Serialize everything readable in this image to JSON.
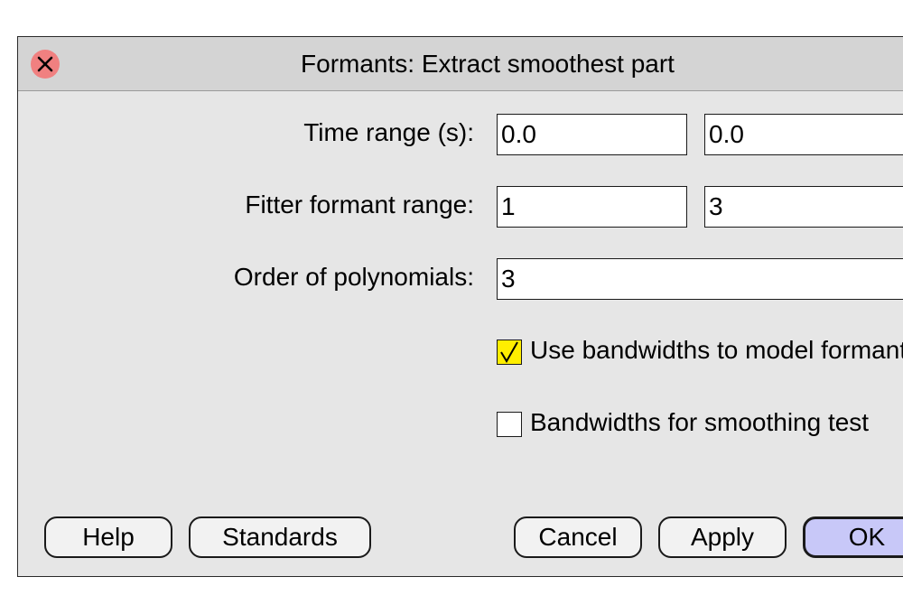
{
  "dialog": {
    "title": "Formants: Extract smoothest part"
  },
  "fields": {
    "time_range_label": "Time range (s):",
    "time_range_from": "0.0",
    "time_range_to": "0.0",
    "fitter_range_label": "Fitter formant range:",
    "fitter_range_from": "1",
    "fitter_range_to": "3",
    "order_label": "Order of polynomials:",
    "order_value": "3"
  },
  "options": {
    "use_bandwidths_label": "Use bandwidths to model formants",
    "use_bandwidths_checked": true,
    "bandwidths_smoothing_label": "Bandwidths for smoothing test",
    "bandwidths_smoothing_checked": false
  },
  "buttons": {
    "help": "Help",
    "standards": "Standards",
    "cancel": "Cancel",
    "apply": "Apply",
    "ok": "OK"
  },
  "icons": {
    "close": "close-icon",
    "checkmark": "checkmark-icon"
  },
  "colors": {
    "close_button": "#f08080",
    "dialog_background": "#e6e6e6",
    "checked_background": "#ffee00",
    "default_button": "#c8c8f8"
  }
}
